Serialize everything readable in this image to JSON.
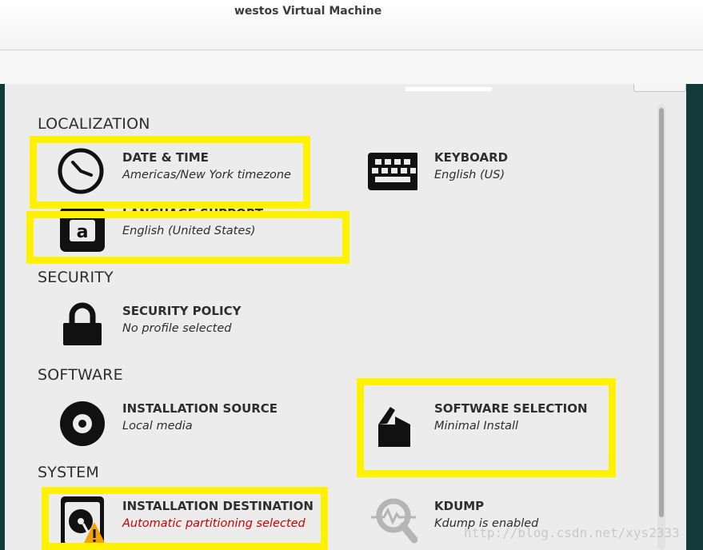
{
  "window": {
    "title": "westos Virtual Machine"
  },
  "categories": {
    "localization": "LOCALIZATION",
    "security": "SECURITY",
    "software": "SOFTWARE",
    "system": "SYSTEM"
  },
  "spokes": {
    "date_time": {
      "name": "DATE & TIME",
      "status": "Americas/New York timezone",
      "icon": "clock-icon"
    },
    "keyboard": {
      "name": "KEYBOARD",
      "status": "English (US)",
      "icon": "keyboard-icon"
    },
    "language_support": {
      "name": "LANGUAGE SUPPORT",
      "status": "English (United States)",
      "icon": "language-icon"
    },
    "security_policy": {
      "name": "SECURITY POLICY",
      "status": "No profile selected",
      "icon": "lock-icon"
    },
    "installation_source": {
      "name": "INSTALLATION SOURCE",
      "status": "Local media",
      "icon": "disc-icon"
    },
    "software_selection": {
      "name": "SOFTWARE SELECTION",
      "status": "Minimal Install",
      "icon": "package-icon"
    },
    "installation_destination": {
      "name": "INSTALLATION DESTINATION",
      "status": "Automatic partitioning selected",
      "icon": "harddisk-warning-icon"
    },
    "kdump": {
      "name": "KDUMP",
      "status": "Kdump is enabled",
      "icon": "kdump-search-icon"
    }
  },
  "colors": {
    "highlight": "#fff200",
    "warning": "#cc0000",
    "text": "#2e2e2e",
    "background": "#ececec",
    "guest_edge": "#123a3a"
  },
  "watermark": "http://blog.csdn.net/xys2333"
}
